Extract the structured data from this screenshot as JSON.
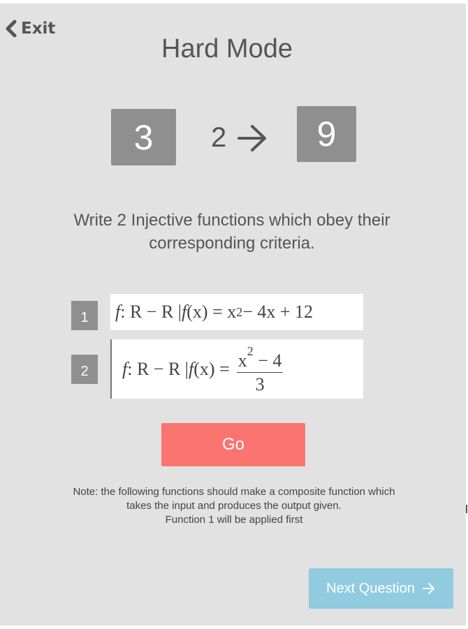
{
  "header": {
    "exit_label": "Exit",
    "title": "Hard Mode"
  },
  "puzzle": {
    "input": "3",
    "function_count": "2",
    "output": "9",
    "instruction": "Write 2 Injective functions which obey their corresponding criteria."
  },
  "functions": [
    {
      "number": "1",
      "prefix": "f",
      "mapping": ": R − R | ",
      "fx": "f",
      "arg": "(x) = x",
      "exponent": "2",
      "rest": " − 4x + 12"
    },
    {
      "number": "2",
      "prefix": "f",
      "mapping": ": R − R | ",
      "fx": "f",
      "arg": "(x) = ",
      "numerator_base": "x",
      "numerator_exponent": "2",
      "numerator_rest": " − 4",
      "denominator": "3"
    }
  ],
  "actions": {
    "go_label": "Go",
    "next_label": "Next Question"
  },
  "note": {
    "line1": "Note: the following functions should make a composite function which",
    "line2": "takes the input and produces the output given.",
    "line3": "Function 1 will be applied first"
  },
  "colors": {
    "background": "#e2e2e2",
    "tile": "#8f8f8f",
    "go_button": "#fa7570",
    "next_button": "#90cbe0",
    "text": "#555555"
  },
  "icons": {
    "exit": "chevron-left-icon",
    "arrow": "arrow-right-icon",
    "next": "arrow-right-icon"
  }
}
